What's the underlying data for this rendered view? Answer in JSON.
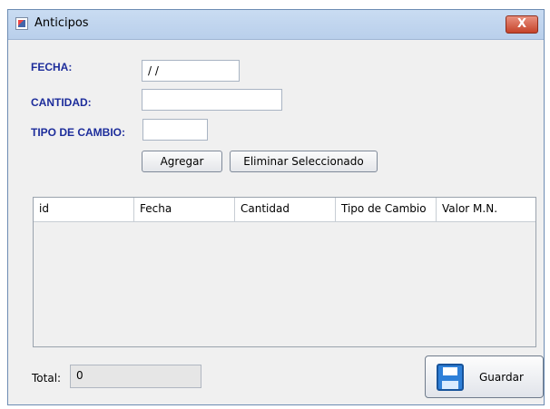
{
  "window": {
    "title": "Anticipos",
    "close_glyph": "X"
  },
  "form": {
    "fecha_label": "FECHA:",
    "fecha_value": "/ /",
    "cantidad_label": "CANTIDAD:",
    "cantidad_value": "",
    "tipo_cambio_label": "TIPO DE CAMBIO:",
    "tipo_cambio_value": "",
    "agregar_label": "Agregar",
    "eliminar_label": "Eliminar Seleccionado"
  },
  "table": {
    "columns": [
      "id",
      "Fecha",
      "Cantidad",
      "Tipo de Cambio",
      "Valor M.N."
    ],
    "rows": []
  },
  "footer": {
    "total_label": "Total:",
    "total_value": "0",
    "save_label": "Guardar",
    "save_icon": "floppy-disk-icon"
  }
}
